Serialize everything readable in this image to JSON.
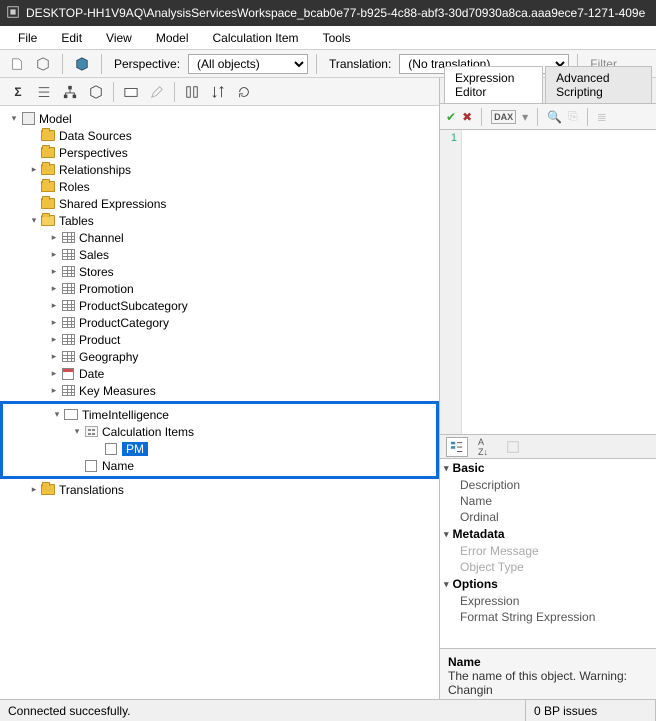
{
  "title": "DESKTOP-HH1V9AQ\\AnalysisServicesWorkspace_bcab0e77-b925-4c88-abf3-30d70930a8ca.aaa9ece7-1271-409e",
  "menu": {
    "file": "File",
    "edit": "Edit",
    "view": "View",
    "model": "Model",
    "calc": "Calculation Item",
    "tools": "Tools"
  },
  "toolbar": {
    "perspective_label": "Perspective:",
    "perspective_value": "(All objects)",
    "translation_label": "Translation:",
    "translation_value": "(No translation)",
    "filter_label": "Filter"
  },
  "tree": {
    "root": "Model",
    "data_sources": "Data Sources",
    "perspectives": "Perspectives",
    "relationships": "Relationships",
    "roles": "Roles",
    "shared_expressions": "Shared Expressions",
    "tables": "Tables",
    "table_items": [
      "Channel",
      "Sales",
      "Stores",
      "Promotion",
      "ProductSubcategory",
      "ProductCategory",
      "Product",
      "Geography",
      "Date",
      "Key Measures"
    ],
    "time_intel": "TimeIntelligence",
    "calc_items": "Calculation Items",
    "pm": "PM",
    "name_item": "Name",
    "translations": "Translations"
  },
  "right": {
    "tabs": {
      "expr": "Expression Editor",
      "adv": "Advanced Scripting"
    },
    "gutter": "1",
    "props": {
      "sections": {
        "basic": "Basic",
        "metadata": "Metadata",
        "options": "Options"
      },
      "rows": {
        "description": "Description",
        "name": "Name",
        "ordinal": "Ordinal",
        "error_message": "Error Message",
        "object_type": "Object Type",
        "expression": "Expression",
        "format_string": "Format String Expression"
      },
      "desc_title": "Name",
      "desc_body": "The name of this object. Warning: Changin"
    }
  },
  "status": {
    "left": "Connected succesfully.",
    "right": "0 BP issues"
  }
}
